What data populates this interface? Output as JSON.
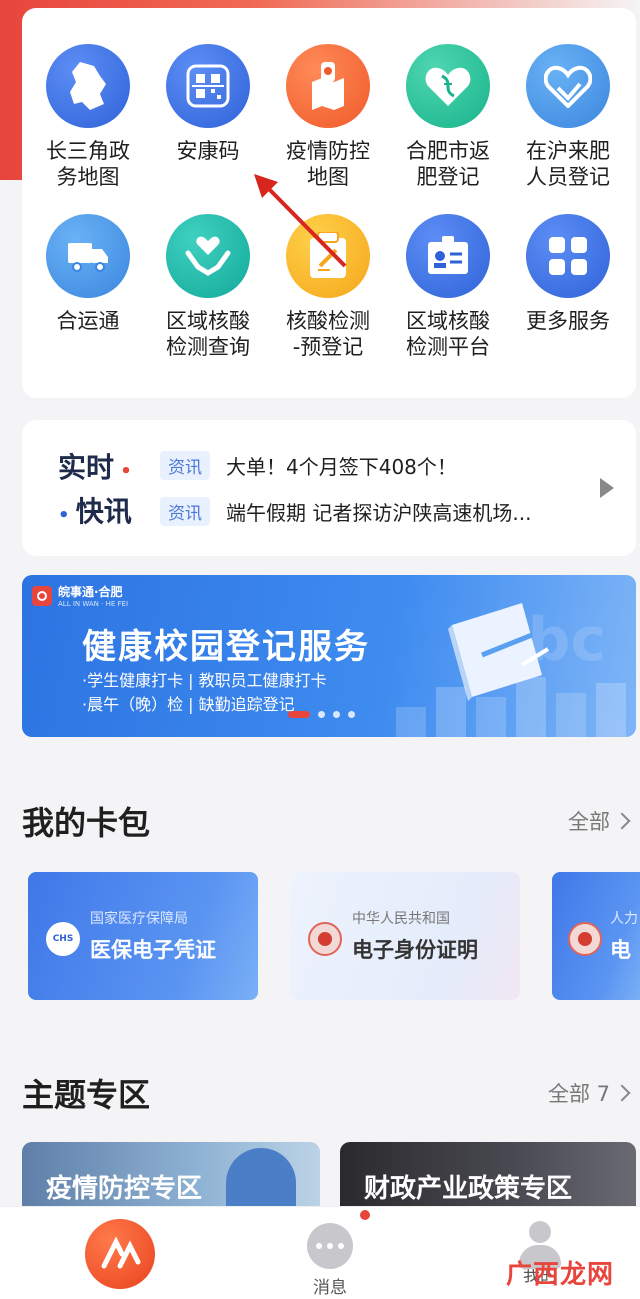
{
  "services": [
    {
      "label": "长三角政\n务地图",
      "icon": "map-icon",
      "color": "blue"
    },
    {
      "label": "安康码",
      "icon": "qr-code-icon",
      "color": "blue"
    },
    {
      "label": "疫情防控\n地图",
      "icon": "epidemic-map-icon",
      "color": "orange"
    },
    {
      "label": "合肥市返\n肥登记",
      "icon": "dna-heart-icon",
      "color": "green"
    },
    {
      "label": "在沪来肥\n人员登记",
      "icon": "heart-shield-icon",
      "color": "sky"
    },
    {
      "label": "合运通",
      "icon": "truck-icon",
      "color": "sky"
    },
    {
      "label": "区域核酸\n检测查询",
      "icon": "hands-heart-icon",
      "color": "teal"
    },
    {
      "label": "核酸检测\n-预登记",
      "icon": "form-pen-icon",
      "color": "yellow"
    },
    {
      "label": "区域核酸\n检测平台",
      "icon": "id-card-icon",
      "color": "blue"
    },
    {
      "label": "更多服务",
      "icon": "grid-icon",
      "color": "blue"
    }
  ],
  "news": {
    "logo_line1": "实时",
    "logo_line2": "快讯",
    "items": [
      {
        "tag": "资讯",
        "text": "大单！4个月签下408个！"
      },
      {
        "tag": "资讯",
        "text": "端午假期 记者探访沪陕高速机场..."
      }
    ]
  },
  "banner": {
    "brand": "皖事通·合肥",
    "brand_sub": "ALL IN WAN · HE FEI",
    "title": "健康校园登记服务",
    "line1": "·学生健康打卡 | 教职员工健康打卡",
    "line2": "·晨午（晚）检 | 缺勤追踪登记",
    "watermark": "abc"
  },
  "wallet": {
    "title": "我的卡包",
    "more": "全部",
    "cards": [
      {
        "issuer": "国家医疗保障局",
        "name": "医保电子凭证",
        "emblem_text": "CHS"
      },
      {
        "issuer": "中华人民共和国",
        "name": "电子身份证明"
      },
      {
        "issuer": "人力",
        "name": "电"
      }
    ]
  },
  "topics": {
    "title": "主题专区",
    "more": "全部 7",
    "items": [
      {
        "label": "疫情防控专区"
      },
      {
        "label": "财政产业政策专区"
      }
    ]
  },
  "tabbar": {
    "home_label": "",
    "message_label": "消息",
    "me_label": "我的"
  },
  "watermark_text": "广西龙网",
  "colors": {
    "accent": "#e8453c",
    "primary_blue": "#2f62d8"
  }
}
